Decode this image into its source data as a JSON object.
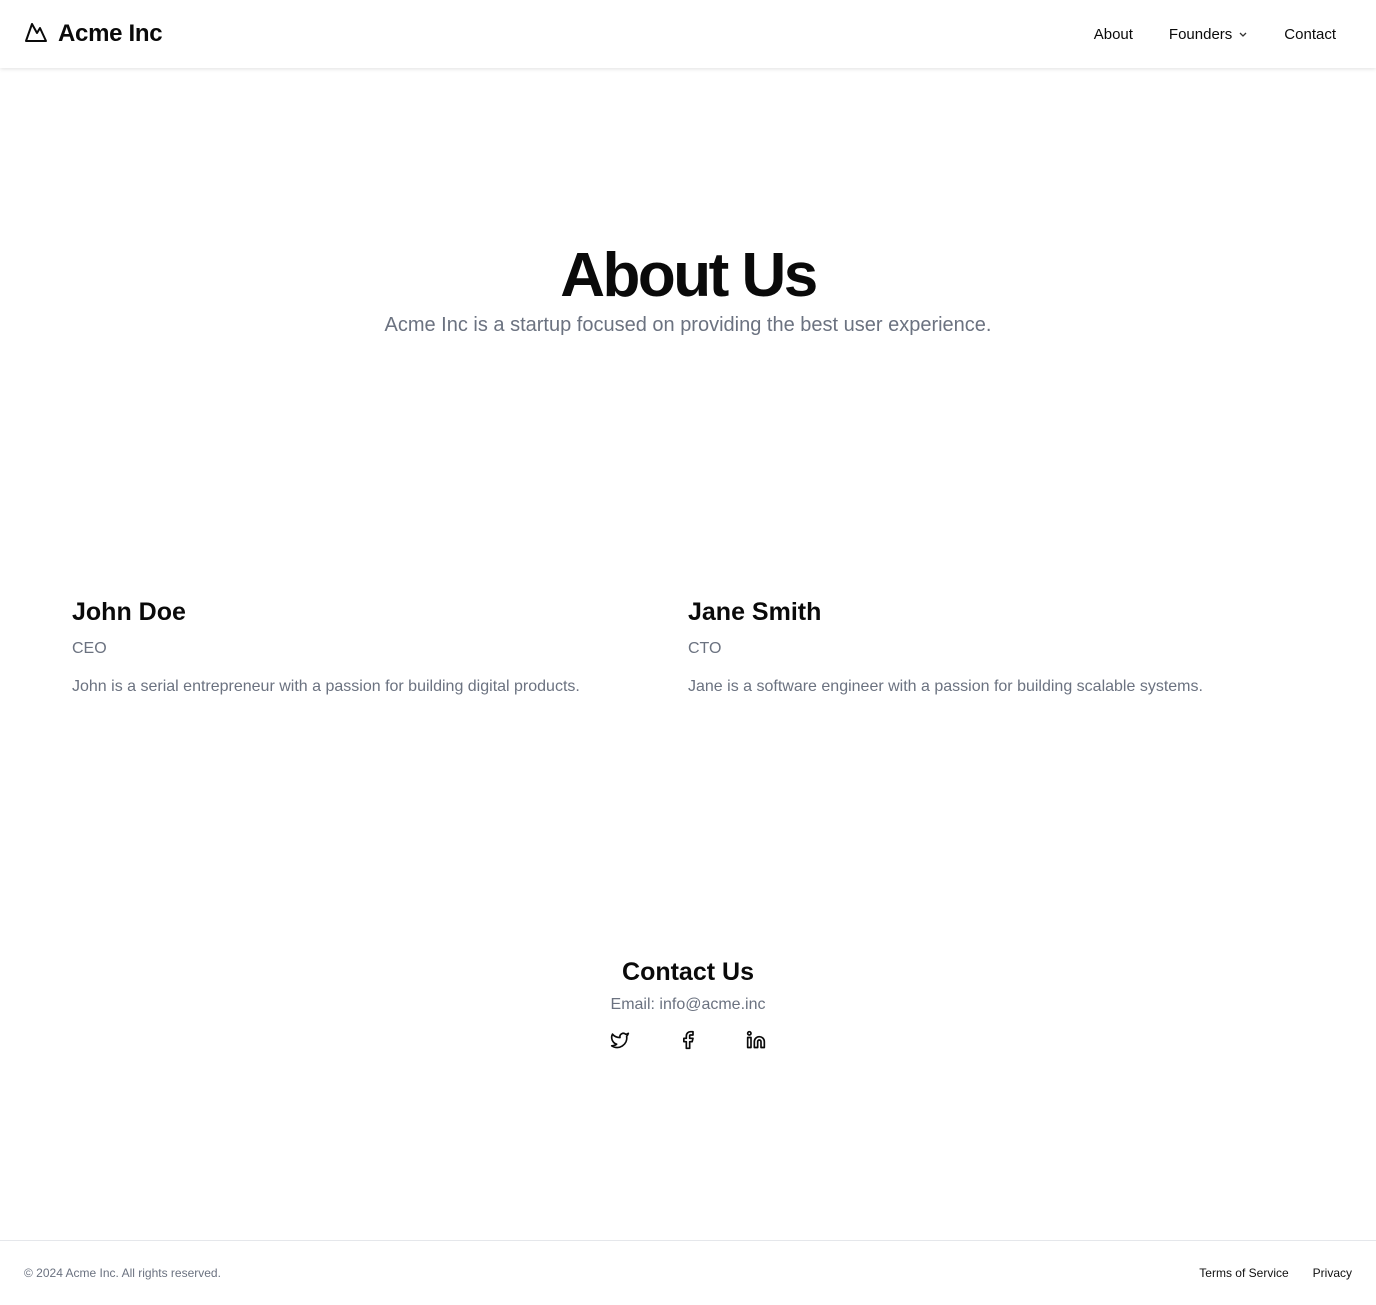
{
  "header": {
    "brand_icon": "mountain-icon",
    "brand_name": "Acme Inc",
    "nav": [
      {
        "label": "About"
      },
      {
        "label": "Founders",
        "icon": "chevron-down-icon"
      },
      {
        "label": "Contact"
      }
    ]
  },
  "hero": {
    "title": "About Us",
    "subtitle": "Acme Inc is a startup focused on providing the best user experience."
  },
  "founders": [
    {
      "name": "John Doe",
      "role": "CEO",
      "bio": "John is a serial entrepreneur with a passion for building digital products."
    },
    {
      "name": "Jane Smith",
      "role": "CTO",
      "bio": "Jane is a software engineer with a passion for building scalable systems."
    }
  ],
  "contact": {
    "title": "Contact Us",
    "email_text": "Email: info@acme.inc",
    "socials": [
      "twitter-icon",
      "facebook-icon",
      "linkedin-icon"
    ]
  },
  "footer": {
    "copyright": "© 2024 Acme Inc. All rights reserved.",
    "links": [
      {
        "label": "Terms of Service"
      },
      {
        "label": "Privacy"
      }
    ]
  }
}
